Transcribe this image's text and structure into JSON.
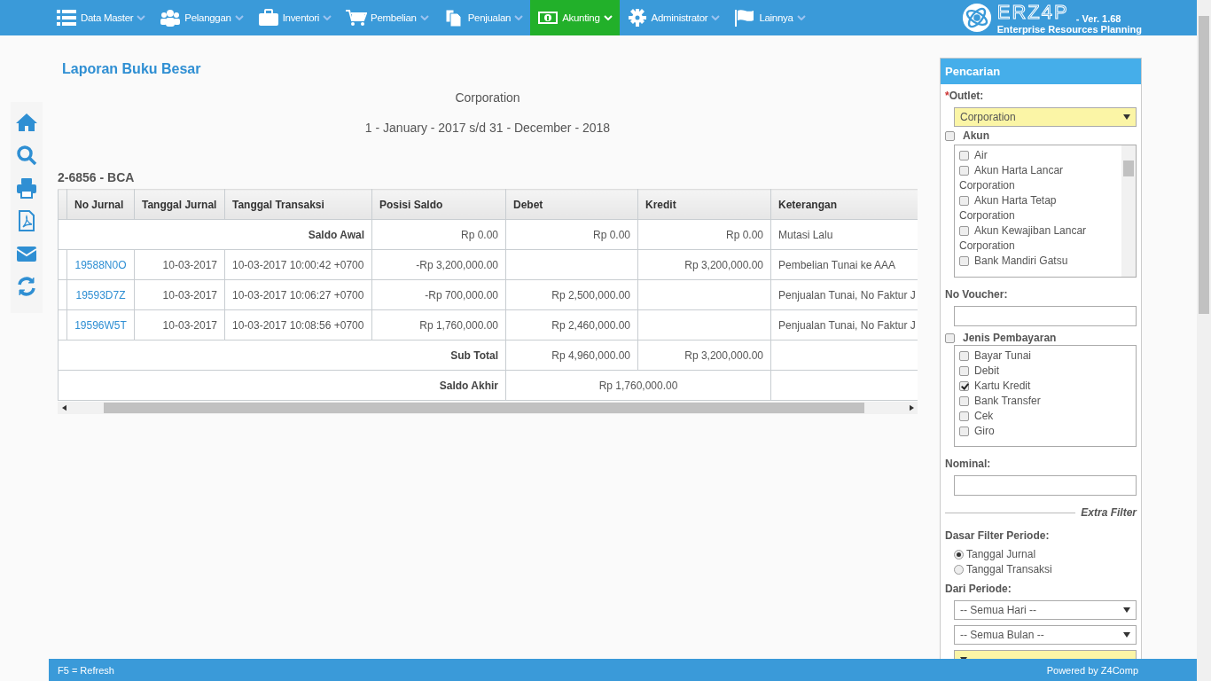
{
  "nav": {
    "items": [
      {
        "label": "Data Master",
        "selected": false
      },
      {
        "label": "Pelanggan",
        "selected": false
      },
      {
        "label": "Inventori",
        "selected": false
      },
      {
        "label": "Pembelian",
        "selected": false
      },
      {
        "label": "Penjualan",
        "selected": false
      },
      {
        "label": "Akunting",
        "selected": true
      },
      {
        "label": "Administrator",
        "selected": false
      },
      {
        "label": "Lainnya",
        "selected": false
      }
    ],
    "brand": {
      "name": "ERZ4P",
      "version": "- Ver. 1.68",
      "tagline": "Enterprise Resources Planning"
    }
  },
  "report": {
    "title": "Laporan Buku Besar",
    "company": "Corporation",
    "period": "1 - January - 2017 s/d 31 - December - 2018",
    "account": "2-6856 - BCA",
    "table": {
      "columns": [
        "No Jurnal",
        "Tanggal Jurnal",
        "Tanggal Transaksi",
        "Posisi Saldo",
        "Debet",
        "Kredit",
        "Keterangan"
      ],
      "rows": [
        {
          "kind": "opening",
          "caption": "Saldo Awal",
          "posisi": "Rp 0.00",
          "debet": "Rp 0.00",
          "kredit": "Rp 0.00",
          "keterangan": "Mutasi Lalu"
        },
        {
          "kind": "entry",
          "no_jurnal": "19588N0O",
          "tanggal_jurnal": "10-03-2017",
          "tanggal_transaksi": "10-03-2017 10:00:42 +0700",
          "posisi": "-Rp 3,200,000.00",
          "debet": "",
          "kredit": "Rp 3,200,000.00",
          "keterangan": "Pembelian Tunai ke AAA"
        },
        {
          "kind": "entry",
          "no_jurnal": "19593D7Z",
          "tanggal_jurnal": "10-03-2017",
          "tanggal_transaksi": "10-03-2017 10:06:27 +0700",
          "posisi": "-Rp 700,000.00",
          "debet": "Rp 2,500,000.00",
          "kredit": "",
          "keterangan": "Penjualan Tunai, No Faktur J"
        },
        {
          "kind": "entry",
          "no_jurnal": "19596W5T",
          "tanggal_jurnal": "10-03-2017",
          "tanggal_transaksi": "10-03-2017 10:08:56 +0700",
          "posisi": "Rp 1,760,000.00",
          "debet": "Rp 2,460,000.00",
          "kredit": "",
          "keterangan": "Penjualan Tunai, No Faktur J"
        },
        {
          "kind": "subtotal",
          "label": "Sub Total",
          "debet": "Rp 4,960,000.00",
          "kredit": "Rp 3,200,000.00"
        },
        {
          "kind": "closing",
          "label": "Saldo Akhir",
          "value": "Rp 1,760,000.00"
        }
      ]
    }
  },
  "search_panel": {
    "title": "Pencarian",
    "required_mark": "*",
    "outlet_label": "Outlet:",
    "outlet": "Corporation",
    "akun": {
      "label": "Akun",
      "checked": false,
      "items": [
        {
          "label": "Air",
          "checked": false
        },
        {
          "label": "Akun Harta Lancar Corporation",
          "checked": false
        },
        {
          "label": "Akun Harta Tetap Corporation",
          "checked": false
        },
        {
          "label": "Akun Kewajiban Lancar Corporation",
          "checked": false
        },
        {
          "label": "Bank Mandiri Gatsu",
          "checked": false
        }
      ]
    },
    "voucher_label": "No Voucher:",
    "pembayaran": {
      "label": "Jenis Pembayaran",
      "checked": false,
      "items": [
        {
          "label": "Bayar Tunai",
          "checked": false
        },
        {
          "label": "Debit",
          "checked": false
        },
        {
          "label": "Kartu Kredit",
          "checked": true
        },
        {
          "label": "Bank Transfer",
          "checked": false
        },
        {
          "label": "Cek",
          "checked": false
        },
        {
          "label": "Giro",
          "checked": false
        }
      ]
    },
    "nominal_label": "Nominal:",
    "extra_filter": "Extra Filter",
    "dasar_label": "Dasar Filter Periode:",
    "dasar_options": [
      {
        "label": "Tanggal Jurnal",
        "selected": true
      },
      {
        "label": "Tanggal Transaksi",
        "selected": false
      }
    ],
    "dari_label": "Dari Periode:",
    "dari_selects": [
      {
        "value": "-- Semua Hari --",
        "highlighted": false
      },
      {
        "value": "-- Semua Bulan --",
        "highlighted": false
      },
      {
        "highlighted": true
      }
    ]
  },
  "footer": {
    "left": "F5 = Refresh",
    "right": "Powered by Z4Comp"
  }
}
